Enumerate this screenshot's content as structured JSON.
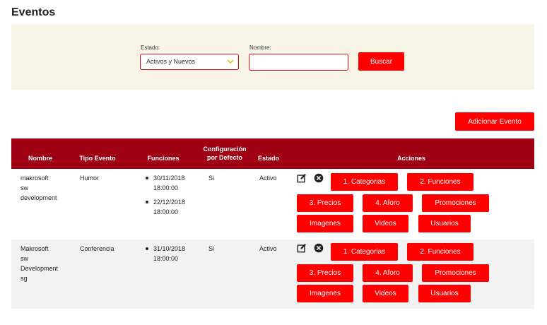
{
  "page": {
    "title": "Eventos"
  },
  "filters": {
    "estado_label": "Estado:",
    "estado_value": "Activos y Nuevos",
    "nombre_label": "Nombre:",
    "nombre_value": "",
    "nombre_placeholder": "",
    "search_button": "Buscar"
  },
  "add_event_button": "Adicionar Evento",
  "table": {
    "headers": {
      "nombre": "Nombre",
      "tipo": "Tipo Evento",
      "funciones": "Funciones",
      "config_line1": "Configuración",
      "config_line2": "por Defecto",
      "estado": "Estado",
      "acciones": "Acciones"
    },
    "rows": [
      {
        "nombre_lines": [
          "makrosoft",
          "sw",
          "development"
        ],
        "tipo": "Humor",
        "funciones": [
          {
            "date": "30/11/2018",
            "time": "18:00:00"
          },
          {
            "date": "22/12/2018",
            "time": "18:00:00"
          }
        ],
        "config": "Si",
        "estado": "Activo"
      },
      {
        "nombre_lines": [
          "Makrosoft",
          "sw",
          "Development",
          "sg"
        ],
        "tipo": "Conferencia",
        "funciones": [
          {
            "date": "31/10/2018",
            "time": "18:00:00"
          }
        ],
        "config": "Si",
        "estado": "Activo"
      }
    ],
    "actions": {
      "categorias": "1. Categorias",
      "funciones": "2. Funciones",
      "precios": "3. Precios",
      "aforo": "4. Aforo",
      "promociones": "Promociones",
      "imagenes": "Imagenes",
      "videos": "Videos",
      "usuarios": "Usuarios"
    }
  },
  "colors": {
    "accent": "#ff0000",
    "header_bg": "#a00014",
    "filter_bg": "#f8f4e6",
    "row_alt_bg": "#f2f2f2",
    "chevron": "#e0b400"
  },
  "icons": {
    "edit": "edit-icon",
    "delete": "delete-icon",
    "dropdown": "chevron-down-icon"
  }
}
